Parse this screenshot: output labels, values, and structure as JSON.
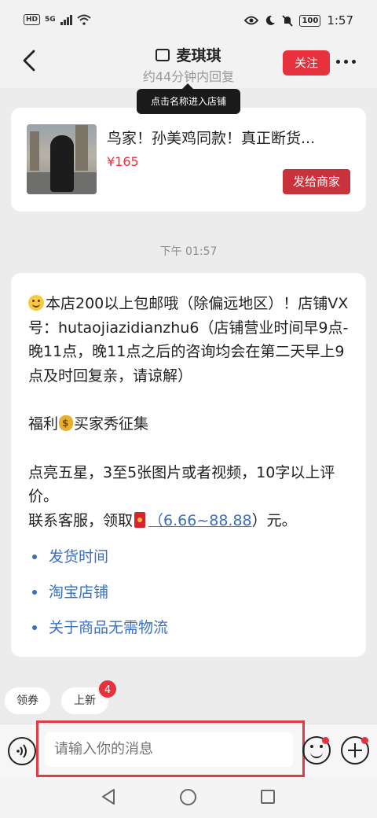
{
  "status_bar": {
    "network_hd": "HD",
    "network_gen": "5G",
    "battery": "100",
    "time": "1:57"
  },
  "header": {
    "shop_name": "麦琪琪",
    "reply_time": "约44分钟内回复",
    "follow_label": "关注",
    "tooltip": "点击名称进入店铺"
  },
  "product": {
    "title": "鸟家！孙美鸡同款！真正断货...",
    "price": "¥165",
    "send_label": "发给商家"
  },
  "chat": {
    "timestamp": "下午 01:57",
    "message": {
      "para1": "本店200以上包邮哦（除偏远地区）！店铺VX号：hutaojiazidianzhu6（店铺营业时间早9点-晚11点，晚11点之后的咨询均会在第二天早上9点及时回复亲，请谅解）",
      "para2_a": "福利",
      "para2_b": "买家秀征集",
      "para3": "点亮五星，3至5张图片或者视频，10字以上评价。",
      "para4_a": "联系客服，领取",
      "para4_link": "（6.66~88.88",
      "para4_b": "）元。",
      "links": [
        "发货时间",
        "淘宝店铺",
        "关于商品无需物流"
      ]
    }
  },
  "quick_chips": {
    "coupon": "领券",
    "new_arrivals": "上新",
    "new_badge": "4"
  },
  "input": {
    "placeholder": "请输入你的消息"
  },
  "icons": {
    "voice": "voice-icon",
    "emoji": "emoji-icon",
    "plus": "plus-icon",
    "back": "back-arrow-icon"
  },
  "colors": {
    "accent": "#e7323e",
    "link": "#3a6fc0",
    "highlight_border": "#e23a46"
  }
}
